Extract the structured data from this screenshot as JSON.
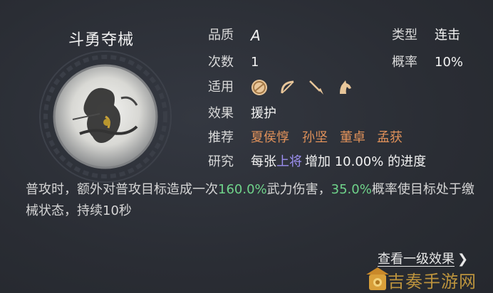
{
  "skill": {
    "title": "斗勇夺械"
  },
  "info": {
    "quality_label": "品质",
    "quality_value": "A",
    "type_label": "类型",
    "type_value": "连击",
    "count_label": "次数",
    "count_value": "1",
    "rate_label": "概率",
    "rate_value": "10%",
    "apply_label": "适用",
    "apply_icons": [
      "shield-icon",
      "bow-icon",
      "spear-icon",
      "horse-icon"
    ],
    "effect_label": "效果",
    "effect_value": "援护",
    "recommend_label": "推荐",
    "recommend": [
      "夏侯惇",
      "孙坚",
      "董卓",
      "孟获"
    ],
    "research_label": "研究",
    "research_prefix": "每张",
    "research_highlight": "上将",
    "research_suffix": "增加 10.00% 的进度"
  },
  "description": {
    "part1": "普攻时，额外对普攻目标造成一次",
    "dmg": "160.0%",
    "part2": "武力伤害，",
    "prob": "35.0%",
    "part3": "概率使目标处于缴械状态，持续10秒"
  },
  "footer": {
    "more_label": "查看一级效果",
    "watermark_text": "吉奏手游网"
  },
  "colors": {
    "recommend": "#e0915a",
    "highlight": "#9d8ff0",
    "green": "#6fd38a"
  }
}
